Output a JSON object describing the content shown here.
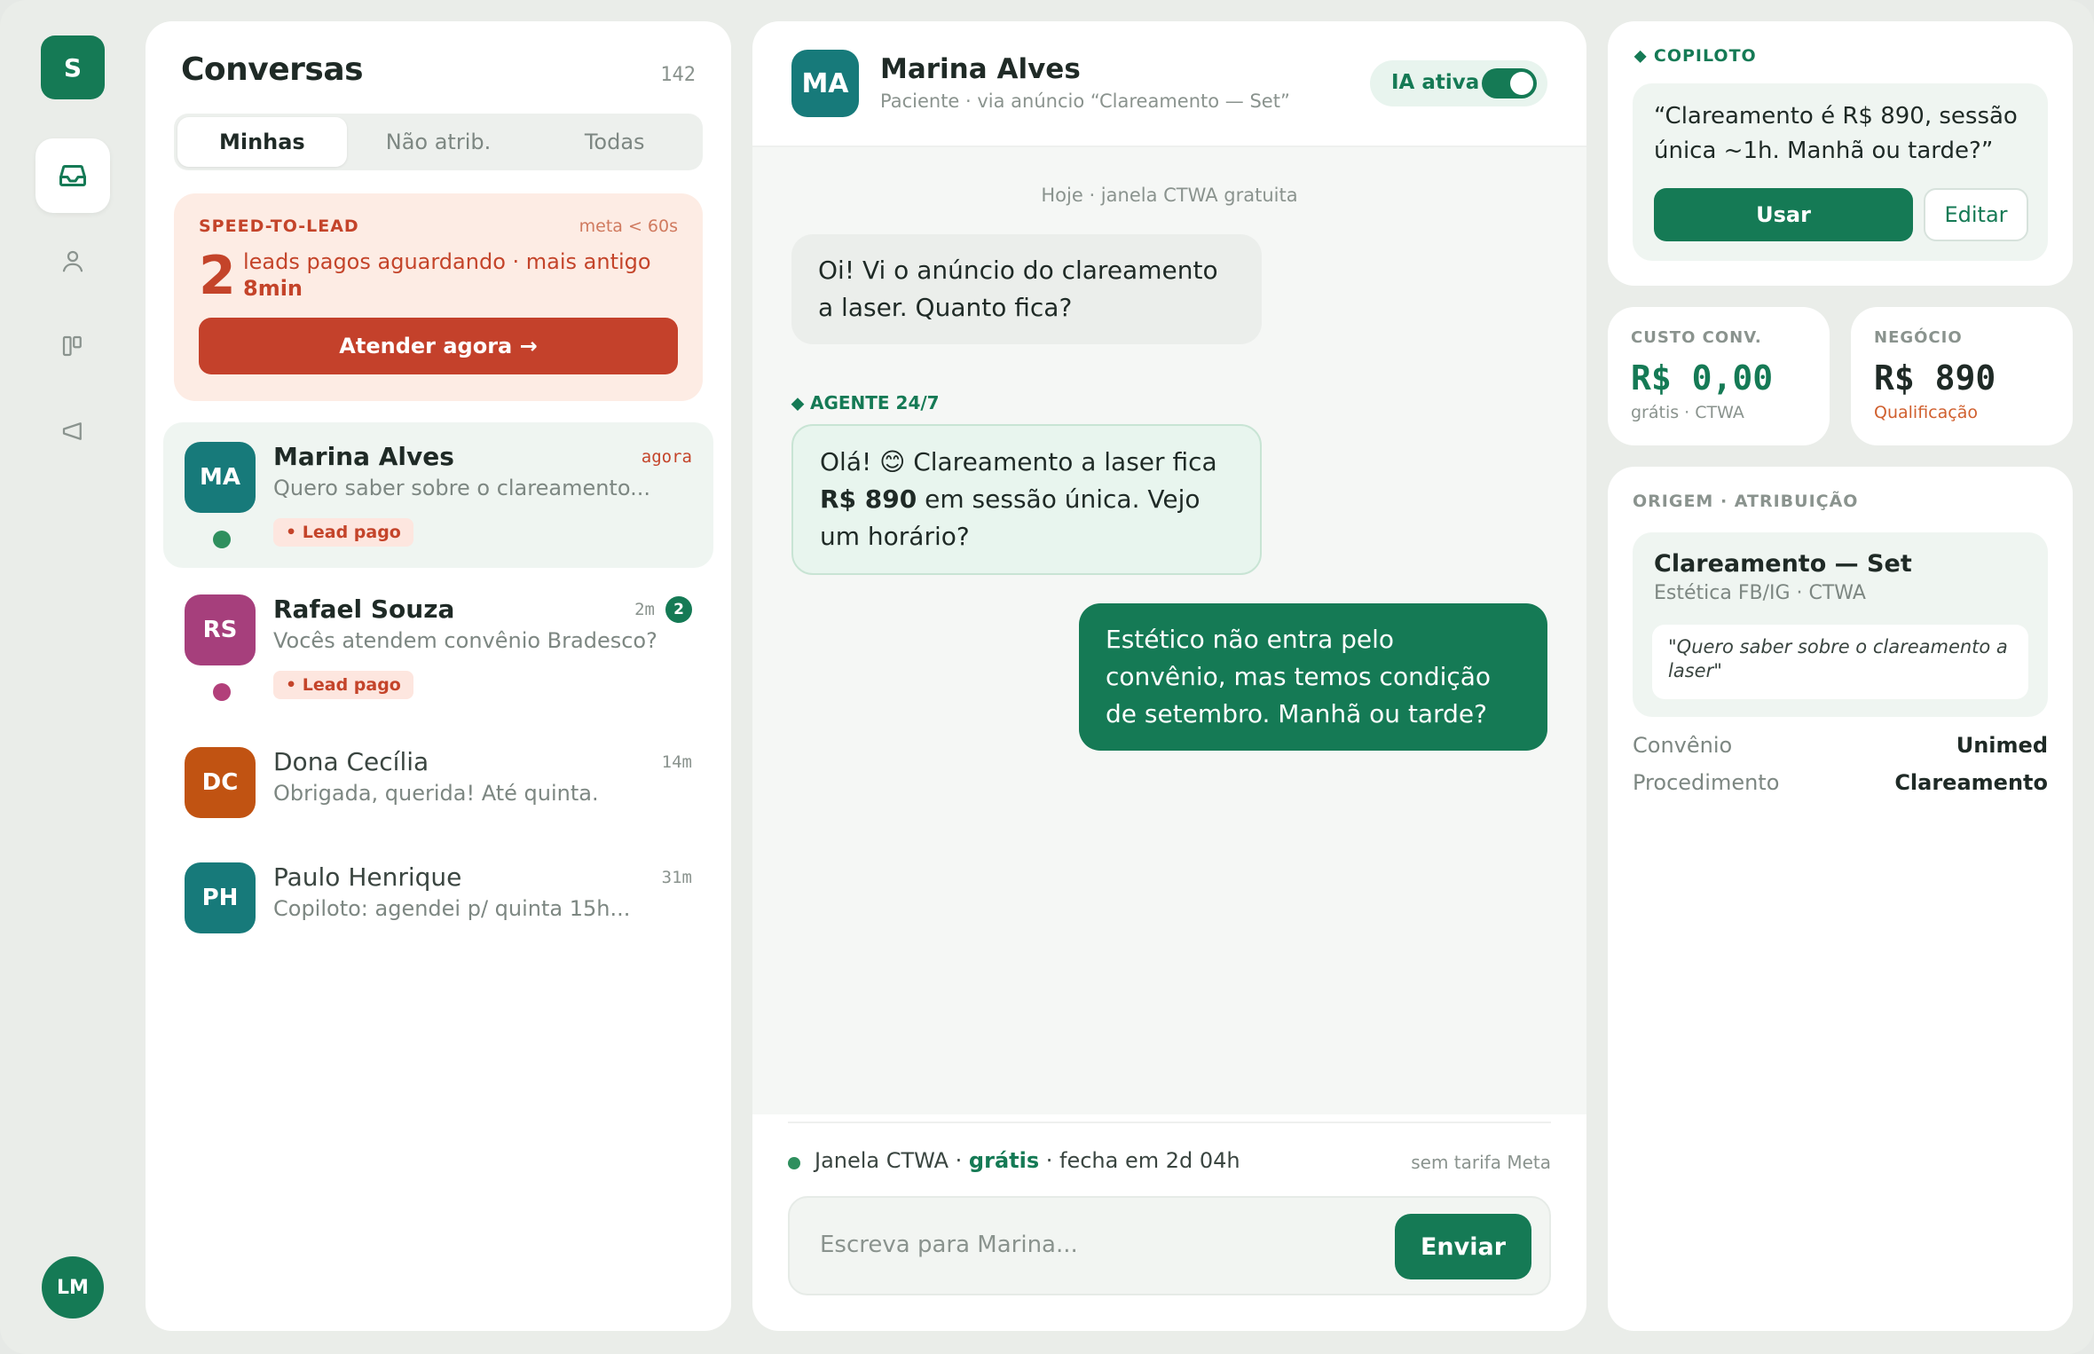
{
  "rail": {
    "brand_initial": "S",
    "user_initials": "LM",
    "icons": [
      "inbox-icon",
      "user-icon",
      "kanban-icon",
      "megaphone-icon"
    ]
  },
  "conversations": {
    "title": "Conversas",
    "count": "142",
    "tabs": [
      "Minhas",
      "Não atrib.",
      "Todas"
    ],
    "active_tab": "Minhas",
    "speed_to_lead": {
      "label": "SPEED-TO-LEAD",
      "meta": "meta < 60s",
      "count": "2",
      "text": "leads pagos aguardando · mais antigo",
      "oldest": "8min",
      "button": "Atender agora →"
    },
    "items": [
      {
        "initials": "MA",
        "name": "Marina Alves",
        "message": "Quero saber sobre o clareamento...",
        "time": "agora",
        "tag": "• Lead pago",
        "avatar_color": "#177a7a",
        "dot_color": "#2e8f5e"
      },
      {
        "initials": "RS",
        "name": "Rafael Souza",
        "message": "Vocês atendem convênio Bradesco?",
        "time": "2m",
        "unread": "2",
        "tag": "• Lead pago",
        "avatar_color": "#a63f7c",
        "dot_color": "#b23f7a"
      },
      {
        "initials": "DC",
        "name": "Dona Cecília",
        "message": "Obrigada, querida! Até quinta.",
        "time": "14m",
        "avatar_color": "#c15312"
      },
      {
        "initials": "PH",
        "name": "Paulo Henrique",
        "message": "Copiloto: agendei p/ quinta 15h...",
        "time": "31m",
        "avatar_color": "#177a7a"
      }
    ]
  },
  "chat": {
    "initials": "MA",
    "name": "Marina Alves",
    "subtitle": "Paciente · via anúncio “Clareamento — Set”",
    "ai_label": "IA ativa",
    "ai_on": true,
    "day_label": "Hoje · janela CTWA gratuita",
    "incoming": "Oi! Vi o anúncio do clareamento a laser. Quanto fica?",
    "agent_label": "⬥ AGENTE 24/7",
    "agent_msg_a": "Olá! 😊 Clareamento a laser fica",
    "agent_msg_price": "R$ 890",
    "agent_msg_b": "em sessão única. Vejo um horário?",
    "outgoing": "Estético não entra pelo convênio, mas temos condição de setembro. Manhã ou tarde?",
    "window_text_a": "Janela CTWA ·",
    "window_free": "grátis",
    "window_text_b": "· fecha em 2d 04h",
    "window_right": "sem tarifa Meta",
    "placeholder": "Escreva para Marina...",
    "send": "Enviar"
  },
  "copilot": {
    "label": "⬥ COPILOTO",
    "suggestion": "“Clareamento é R$ 890, sessão única ~1h. Manhã ou tarde?”",
    "use": "Usar",
    "edit": "Editar"
  },
  "kpis": [
    {
      "label": "CUSTO CONV.",
      "value": "R$ 0,00",
      "sub": "grátis · CTWA"
    },
    {
      "label": "NEGÓCIO",
      "value": "R$ 890",
      "sub": "Qualificação"
    }
  ],
  "origin": {
    "label": "ORIGEM · ATRIBUIÇÃO",
    "campaign": "Clareamento — Set",
    "source": "Estética FB/IG · CTWA",
    "quote": "\"Quero saber sobre o clareamento a laser\"",
    "fields": [
      {
        "key": "Convênio",
        "value": "Unimed"
      },
      {
        "key": "Procedimento",
        "value": "Clareamento"
      }
    ]
  },
  "colors": {
    "accent": "#157a55",
    "alert": "#c4412b",
    "background": "#eaede9"
  }
}
